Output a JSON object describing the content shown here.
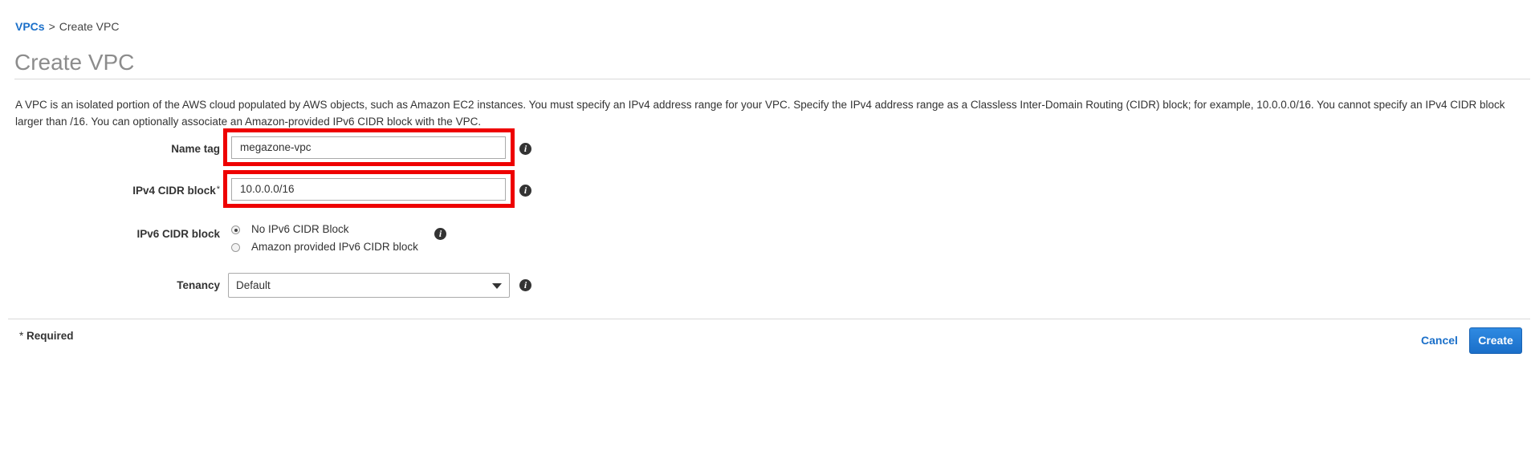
{
  "breadcrumb": {
    "parent": "VPCs",
    "separator": ">",
    "current": "Create VPC"
  },
  "page_title": "Create VPC",
  "description": "A VPC is an isolated portion of the AWS cloud populated by AWS objects, such as Amazon EC2 instances. You must specify an IPv4 address range for your VPC. Specify the IPv4 address range as a Classless Inter-Domain Routing (CIDR) block; for example, 10.0.0.0/16. You cannot specify an IPv4 CIDR block larger than /16. You can optionally associate an Amazon-provided IPv6 CIDR block with the VPC.",
  "form": {
    "name_tag": {
      "label": "Name tag",
      "value": "megazone-vpc",
      "highlighted": true
    },
    "ipv4_cidr": {
      "label": "IPv4 CIDR block",
      "required_mark": "*",
      "value": "10.0.0.0/16",
      "highlighted": true
    },
    "ipv6_cidr": {
      "label": "IPv6 CIDR block",
      "options": [
        {
          "label": "No IPv6 CIDR Block",
          "selected": true
        },
        {
          "label": "Amazon provided IPv6 CIDR block",
          "selected": false
        }
      ]
    },
    "tenancy": {
      "label": "Tenancy",
      "selected": "Default"
    }
  },
  "footer": {
    "required_star": "*",
    "required_label": "Required",
    "cancel_label": "Cancel",
    "create_label": "Create"
  },
  "icons": {
    "info": "info-icon",
    "dropdown": "caret-down-icon"
  },
  "colors": {
    "link": "#1a6fc9",
    "primary_button": "#1a6fc9",
    "highlight": "#ee0000",
    "title": "#8c8c8c"
  }
}
